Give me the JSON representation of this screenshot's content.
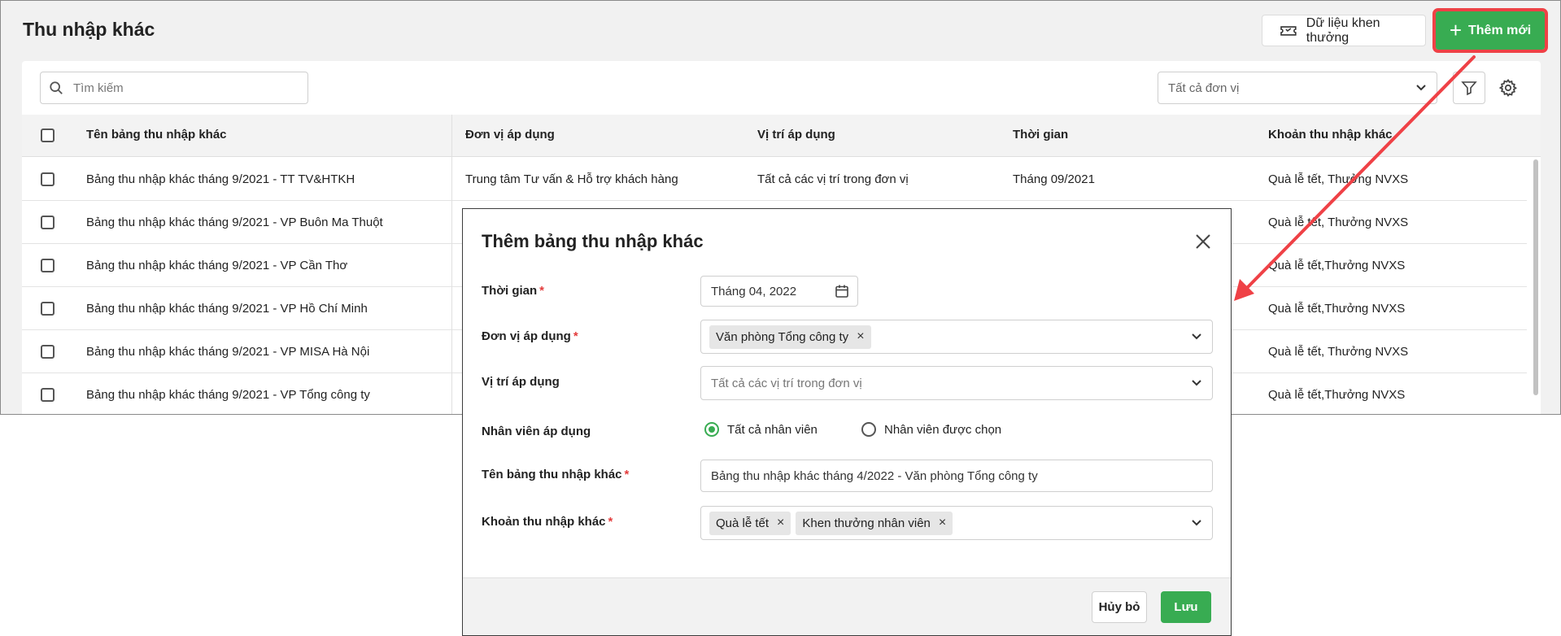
{
  "header": {
    "title": "Thu nhập khác",
    "reward_label": "Dữ liệu khen thưởng",
    "add_label": "Thêm mới"
  },
  "toolbar": {
    "search_placeholder": "Tìm kiếm",
    "unit_filter": "Tất cả đơn vị"
  },
  "table": {
    "columns": [
      "Tên bảng thu nhập khác",
      "Đơn vị áp dụng",
      "Vị trí áp dụng",
      "Thời gian",
      "Khoản thu nhập khác"
    ],
    "rows": [
      {
        "name": "Bảng thu nhập khác tháng 9/2021 - TT TV&HTKH",
        "unit": "Trung tâm Tư vấn & Hỗ trợ khách hàng",
        "position": "Tất cả các vị trí trong đơn vị",
        "time": "Tháng 09/2021",
        "items": "Quà lễ tết, Thưởng NVXS"
      },
      {
        "name": "Bảng thu nhập khác tháng 9/2021 - VP Buôn Ma Thuột",
        "unit": "",
        "position": "",
        "time": "",
        "items": "Quà lễ tết, Thưởng NVXS"
      },
      {
        "name": "Bảng thu nhập khác tháng 9/2021 - VP Cần Thơ",
        "unit": "",
        "position": "",
        "time": "",
        "items": "Quà lễ tết,Thưởng NVXS"
      },
      {
        "name": "Bảng thu nhập khác tháng 9/2021 - VP Hồ Chí Minh",
        "unit": "",
        "position": "",
        "time": "",
        "items": "Quà lễ tết,Thưởng NVXS"
      },
      {
        "name": "Bảng thu nhập khác tháng 9/2021 - VP MISA Hà Nội",
        "unit": "",
        "position": "",
        "time": "",
        "items": "Quà lễ tết, Thưởng NVXS"
      },
      {
        "name": "Bảng thu nhập khác tháng 9/2021 - VP Tổng công ty",
        "unit": "",
        "position": "",
        "time": "",
        "items": "Quà lễ tết,Thưởng NVXS"
      }
    ]
  },
  "modal": {
    "title": "Thêm bảng thu nhập khác",
    "time_label": "Thời gian",
    "time_value": "Tháng 04, 2022",
    "unit_label": "Đơn vị áp dụng",
    "unit_chip": "Văn phòng Tổng công ty",
    "position_label": "Vị trí áp dụng",
    "position_placeholder": "Tất cả các vị trí trong đơn vị",
    "employee_label": "Nhân viên áp dụng",
    "employee_all": "Tất cả nhân viên",
    "employee_selected": "Nhân viên được chọn",
    "name_label": "Tên bảng thu nhập khác",
    "name_value": "Bảng thu nhập khác tháng 4/2022 - Văn phòng Tổng công ty",
    "items_label": "Khoản thu nhập khác",
    "item_chips": [
      "Quà lễ tết",
      "Khen thưởng nhân viên"
    ],
    "required_mark": "*",
    "remove_mark": "×",
    "cancel_label": "Hủy bỏ",
    "save_label": "Lưu"
  },
  "colors": {
    "accent": "#38ac52",
    "highlight": "#ef4146",
    "required": "#e33b3b"
  }
}
